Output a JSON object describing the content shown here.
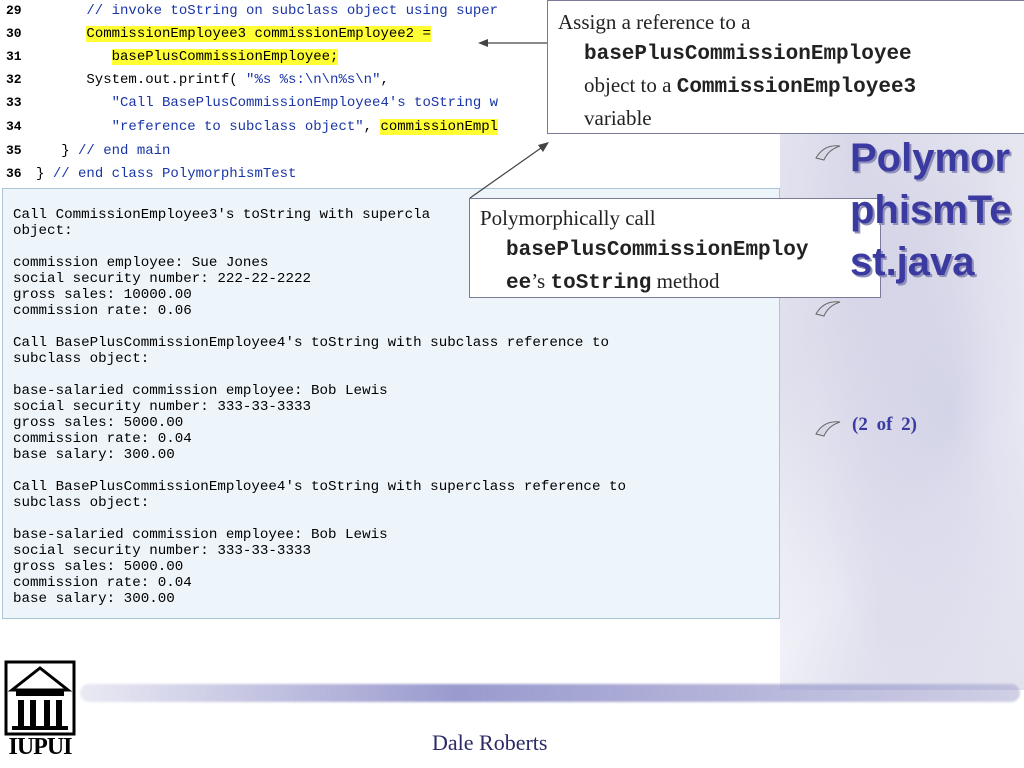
{
  "code": {
    "lines": [
      {
        "num": "29",
        "text": "      // invoke toString on subclass object using super"
      },
      {
        "num": "30",
        "prefix": "      ",
        "hl": "CommissionEmployee3 commissionEmployee2 ="
      },
      {
        "num": "31",
        "prefix": "         ",
        "hl": "basePlusCommissionEmployee;"
      },
      {
        "num": "32",
        "text": "      System.out.printf( ",
        "str": "\"%s %s:\\n\\n%s\\n\"",
        "suffix": ","
      },
      {
        "num": "33",
        "str": "         \"Call BasePlusCommissionEmployee4's toString w"
      },
      {
        "num": "34",
        "str": "         \"reference to subclass object\"",
        "mid": ", ",
        "hl": "commissionEmpl"
      },
      {
        "num": "35",
        "text": "   } ",
        "cmt": "// end main"
      },
      {
        "num": "36",
        "text": "} ",
        "cmt": "// end class PolymorphismTest"
      }
    ]
  },
  "console": {
    "output": "Call CommissionEmployee3's toString with supercla\nobject:\n\ncommission employee: Sue Jones\nsocial security number: 222-22-2222\ngross sales: 10000.00\ncommission rate: 0.06\n\nCall BasePlusCommissionEmployee4's toString with subclass reference to\nsubclass object:\n\nbase-salaried commission employee: Bob Lewis\nsocial security number: 333-33-3333\ngross sales: 5000.00\ncommission rate: 0.04\nbase salary: 300.00\n\nCall BasePlusCommissionEmployee4's toString with superclass reference to\nsubclass object:\n\nbase-salaried commission employee: Bob Lewis\nsocial security number: 333-33-3333\ngross sales: 5000.00\ncommission rate: 0.04\nbase salary: 300.00"
  },
  "callout1": {
    "line1": "Assign a reference to a",
    "mono1": "basePlusCommissionEmployee",
    "line3a": "object to a ",
    "mono2": "CommissionEmployee3",
    "line4": "variable"
  },
  "callout2": {
    "line1": "Polymorphically call",
    "mono1": "basePlusCommissionEmploy",
    "mono2": "ee",
    "text2": "’s ",
    "mono3": "toString",
    "text3": " method"
  },
  "sidebar": {
    "title": "PolymorphismTest.java",
    "page": "(2 of 2)"
  },
  "footer": {
    "author": "Dale Roberts",
    "logo_text": "IUPUI"
  },
  "colors": {
    "accent": "#3a3aa0",
    "highlight": "#ffff33",
    "comment": "#1a35a8",
    "console_bg": "#eef5fa"
  },
  "icons": [
    "bullet-swirl-icon",
    "university-building-icon"
  ]
}
